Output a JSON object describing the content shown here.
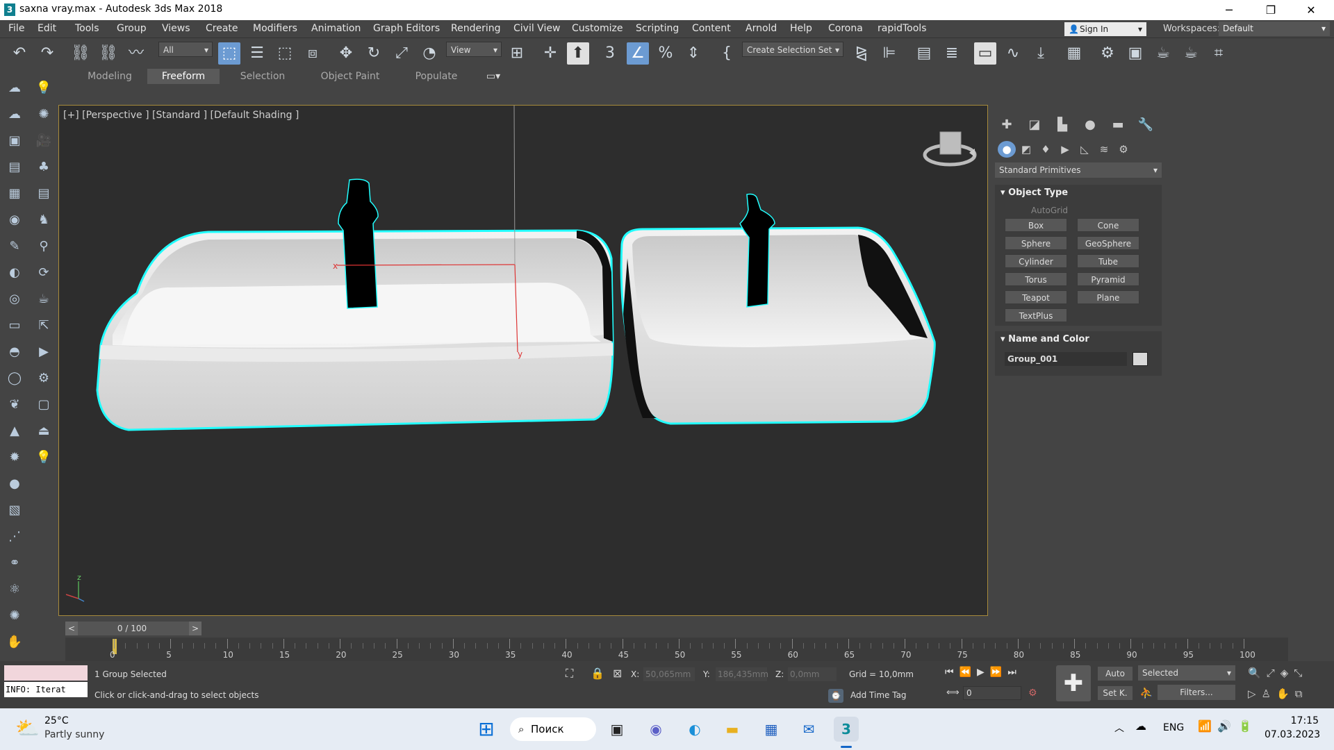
{
  "window": {
    "title": "saxna vray.max - Autodesk 3ds Max 2018",
    "app_icon": "3",
    "minimize": "─",
    "restore": "❐",
    "close": "✕"
  },
  "menu": [
    "File",
    "Edit",
    "Tools",
    "Group",
    "Views",
    "Create",
    "Modifiers",
    "Animation",
    "Graph Editors",
    "Rendering",
    "Civil View",
    "Customize",
    "Scripting",
    "Content",
    "Arnold",
    "Help",
    "Corona",
    "rapidTools"
  ],
  "signin": "Sign In",
  "workspaces": {
    "label": "Workspaces:",
    "value": "Default"
  },
  "toolbar": {
    "filter_value": "All",
    "view_value": "View",
    "selection_set_value": "Create Selection Set"
  },
  "ribbon_tabs": [
    "Modeling",
    "Freeform",
    "Selection",
    "Object Paint",
    "Populate"
  ],
  "viewport": {
    "label": "[+] [Perspective ] [Standard ] [Default Shading ]",
    "axis_x": "x",
    "axis_y": "y",
    "gizmo_z": "z"
  },
  "command_panel": {
    "primitive_dropdown": "Standard Primitives",
    "object_type_header": "Object Type",
    "autogrid": "AutoGrid",
    "buttons": [
      "Box",
      "Cone",
      "Sphere",
      "GeoSphere",
      "Cylinder",
      "Tube",
      "Torus",
      "Pyramid",
      "Teapot",
      "Plane",
      "TextPlus"
    ],
    "name_color_header": "Name and Color",
    "object_name": "Group_001",
    "object_color": "#d9d9d9"
  },
  "timeline": {
    "slider_value": "0 / 100",
    "prev": "<",
    "next": ">",
    "ticks": [
      "0",
      "5",
      "10",
      "15",
      "20",
      "25",
      "30",
      "35",
      "40",
      "45",
      "50",
      "55",
      "60",
      "65",
      "70",
      "75",
      "80",
      "85",
      "90",
      "95",
      "100"
    ]
  },
  "status": {
    "selection": "1 Group Selected",
    "prompt": "Click or click-and-drag to select objects",
    "info": "INFO: Iterat",
    "x_label": "X:",
    "x_value": "50,065mm",
    "y_label": "Y:",
    "y_value": "186,435mm",
    "z_label": "Z:",
    "z_value": "0,0mm",
    "grid": "Grid = 10,0mm",
    "add_time_tag": "Add Time Tag",
    "auto": "Auto",
    "setk": "Set K.",
    "selected": "Selected",
    "filters": "Filters...",
    "frame": "0"
  },
  "taskbar": {
    "weather_temp": "25°C",
    "weather_desc": "Partly sunny",
    "search": "Поиск",
    "lang": "ENG",
    "time": "17:15",
    "date": "07.03.2023"
  }
}
